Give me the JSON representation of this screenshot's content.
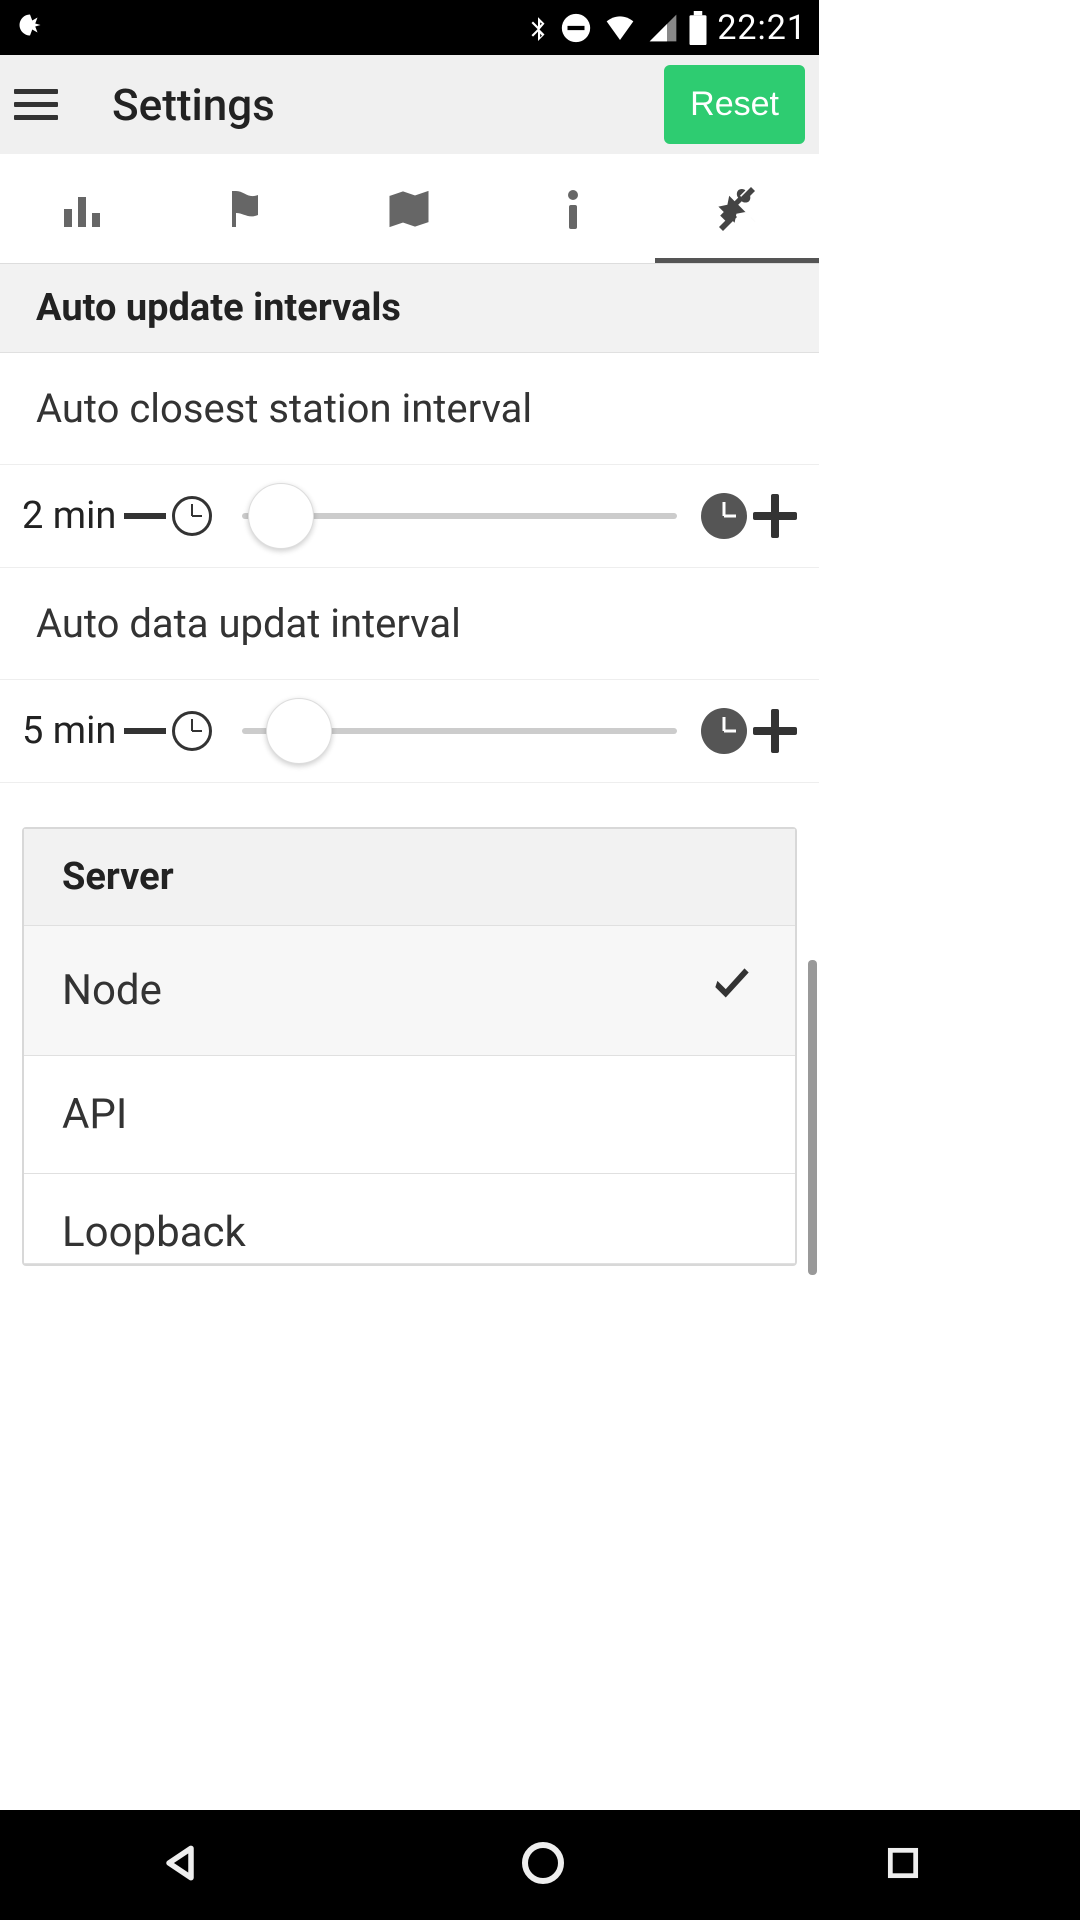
{
  "status": {
    "time": "22:21"
  },
  "header": {
    "title": "Settings",
    "reset_label": "Reset"
  },
  "tabs": [
    "stats",
    "flag",
    "map",
    "info",
    "tools"
  ],
  "section": {
    "title": "Auto update intervals"
  },
  "settings": [
    {
      "label": "Auto closest station interval",
      "value": "2 min",
      "thumb_pct": 9
    },
    {
      "label": "Auto data updat interval",
      "value": "5 min",
      "thumb_pct": 13
    }
  ],
  "server": {
    "title": "Server",
    "options": [
      {
        "label": "Node",
        "selected": true
      },
      {
        "label": "API",
        "selected": false
      },
      {
        "label": "Loopback",
        "selected": false
      }
    ]
  }
}
